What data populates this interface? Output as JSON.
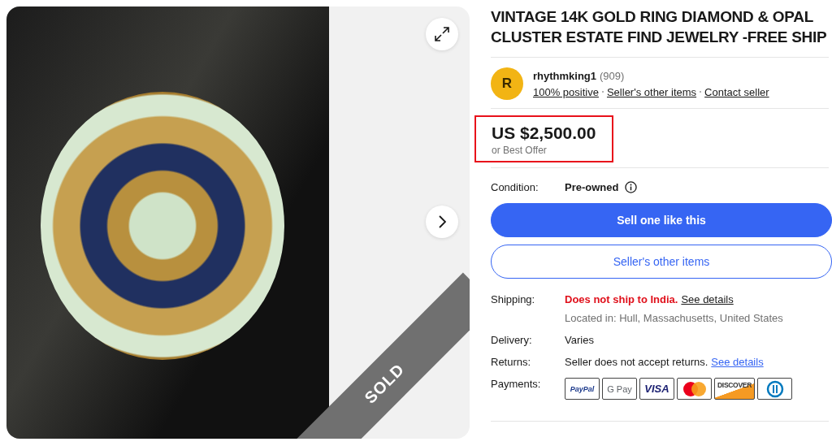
{
  "gallery": {
    "badge": "SOLD"
  },
  "title": "VINTAGE 14K GOLD RING DIAMOND & OPAL CLUSTER ESTATE FIND JEWELRY -FREE SHIP",
  "seller": {
    "avatar_letter": "R",
    "name": "rhythmking1",
    "feedback_count": "(909)",
    "links": [
      "100% positive",
      "Seller's other items",
      "Contact seller"
    ]
  },
  "price": {
    "amount": "US $2,500.00",
    "note": "or Best Offer",
    "highlighted": true
  },
  "condition": {
    "label": "Condition:",
    "value": "Pre-owned"
  },
  "buttons": [
    {
      "kind": "primary",
      "label": "Sell one like this"
    },
    {
      "kind": "secondary",
      "label": "Seller's other items"
    }
  ],
  "details": [
    {
      "label": "Shipping:",
      "value": "Does not ship to India.",
      "alert": true,
      "link": "See details",
      "link_blue": false,
      "note": "Located in: Hull, Massachusetts, United States"
    },
    {
      "label": "Delivery:",
      "value": "Varies",
      "alert": false
    },
    {
      "label": "Returns:",
      "value": "Seller does not accept returns.",
      "alert": false,
      "link": "See details",
      "link_blue": true
    }
  ],
  "payments": {
    "label": "Payments:",
    "methods": [
      {
        "kind": "paypal",
        "label": "PayPal"
      },
      {
        "kind": "gpay",
        "label": "G Pay"
      },
      {
        "kind": "visa",
        "label": "VISA"
      },
      {
        "kind": "mastercard"
      },
      {
        "kind": "discover",
        "label": "DISCOVER"
      },
      {
        "kind": "diners"
      }
    ]
  }
}
